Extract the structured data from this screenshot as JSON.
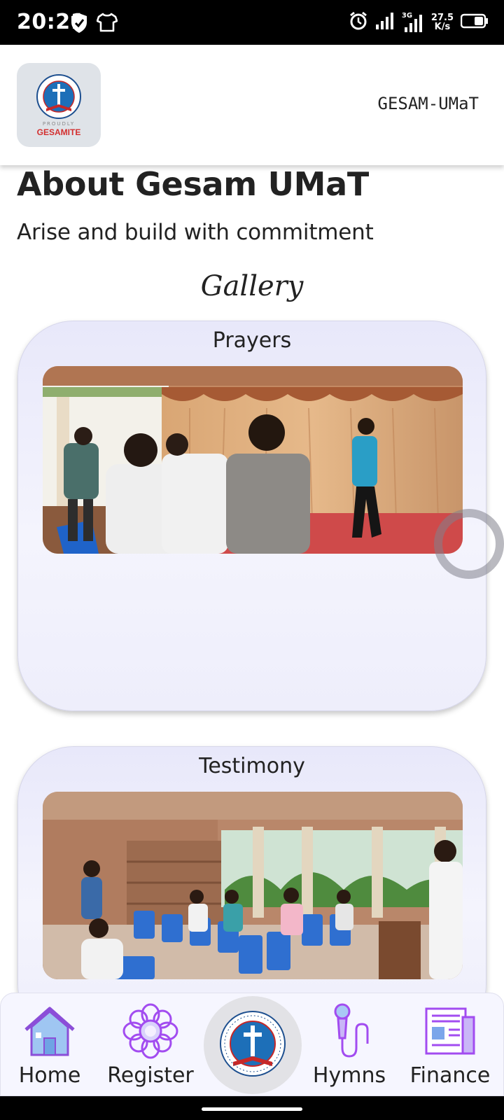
{
  "status_bar": {
    "time": "20:21",
    "network_speed_value": "27.5",
    "network_speed_unit": "K/s",
    "network_type": "3G",
    "left_icons": [
      "shield-check-icon",
      "tshirt-icon"
    ],
    "right_icons": [
      "alarm-icon",
      "signal-icon",
      "signal-3g-icon",
      "battery-icon"
    ]
  },
  "app_bar": {
    "logo_caption_top": "PROUDLY",
    "logo_caption": "GESAMITE",
    "title": "GESAM-UMaT"
  },
  "about": {
    "title": "About Gesam UMaT",
    "subtitle": "Arise and build with commitment"
  },
  "gallery": {
    "title": "Gallery",
    "cards": [
      {
        "title": "Prayers"
      },
      {
        "title": "Testimony"
      }
    ]
  },
  "bottom_nav": {
    "items": [
      {
        "label": "Home",
        "icon": "home-icon"
      },
      {
        "label": "Register",
        "icon": "register-flower-icon"
      },
      {
        "label": "",
        "icon": "gesam-logo-icon"
      },
      {
        "label": "Hymns",
        "icon": "microphone-icon"
      },
      {
        "label": "Finance",
        "icon": "newspaper-icon"
      }
    ]
  },
  "colors": {
    "card_bg": "#ededfb",
    "nav_bg": "#f6f6ff",
    "accent_purple": "#a24cf0",
    "accent_blue": "#5b8def",
    "logo_red": "#d32f2f"
  }
}
